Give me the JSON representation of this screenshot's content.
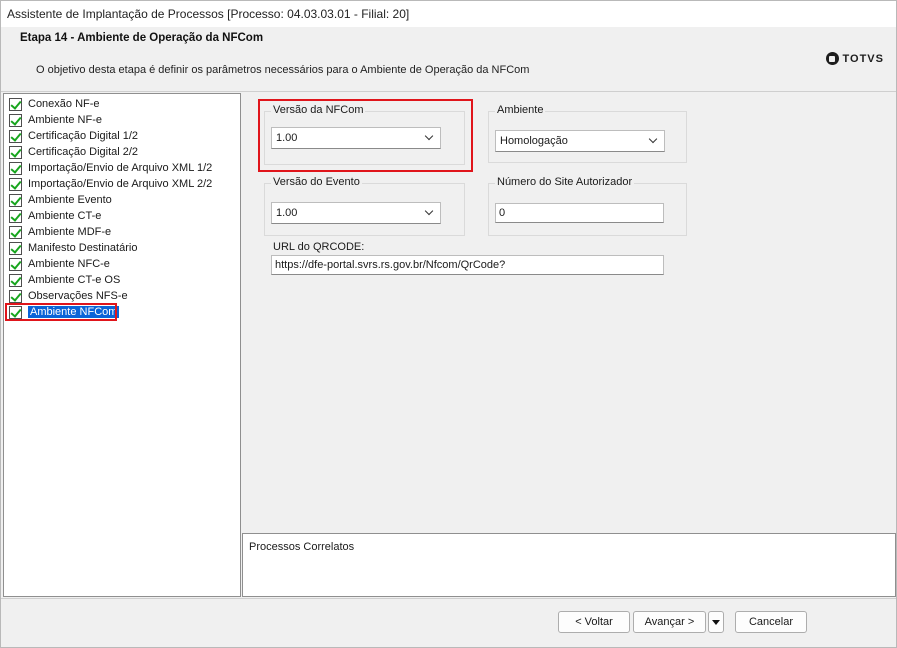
{
  "window": {
    "title": "Assistente de Implantação de Processos [Processo: 04.03.03.01 - Filial: 20]"
  },
  "header": {
    "step_title": "Etapa 14 - Ambiente de Operação da NFCom",
    "description": "O objetivo desta etapa é definir os parâmetros necessários para o Ambiente de Operação da NFCom",
    "logo_text": "TOTVS"
  },
  "sidebar": {
    "items": [
      {
        "label": "Conexão NF-e",
        "checked": true
      },
      {
        "label": "Ambiente NF-e",
        "checked": true
      },
      {
        "label": "Certificação Digital 1/2",
        "checked": true
      },
      {
        "label": "Certificação Digital 2/2",
        "checked": true
      },
      {
        "label": "Importação/Envio de Arquivo XML 1/2",
        "checked": true
      },
      {
        "label": "Importação/Envio de Arquivo XML 2/2",
        "checked": true
      },
      {
        "label": "Ambiente Evento",
        "checked": true
      },
      {
        "label": "Ambiente CT-e",
        "checked": true
      },
      {
        "label": "Ambiente MDF-e",
        "checked": true
      },
      {
        "label": "Manifesto Destinatário",
        "checked": true
      },
      {
        "label": "Ambiente NFC-e",
        "checked": true
      },
      {
        "label": "Ambiente CT-e OS",
        "checked": true
      },
      {
        "label": "Observações NFS-e",
        "checked": true
      },
      {
        "label": "Ambiente NFCom",
        "checked": true,
        "selected": true
      }
    ]
  },
  "form": {
    "versao_nfcom": {
      "label": "Versão da NFCom",
      "value": "1.00"
    },
    "ambiente": {
      "label": "Ambiente",
      "value": "Homologação"
    },
    "versao_evento": {
      "label": "Versão do Evento",
      "value": "1.00"
    },
    "numero_site": {
      "label": "Número do Site Autorizador",
      "value": "0"
    },
    "url_qrcode": {
      "label": "URL do QRCODE:",
      "value": "https://dfe-portal.svrs.rs.gov.br/Nfcom/QrCode?"
    }
  },
  "processos": {
    "label": "Processos Correlatos"
  },
  "footer": {
    "back_label": "< Voltar",
    "next_label": "Avançar >",
    "cancel_label": "Cancelar"
  },
  "colors": {
    "highlight_red": "#e0151b",
    "selection_blue": "#0a64d8",
    "check_green": "#17a51d"
  }
}
